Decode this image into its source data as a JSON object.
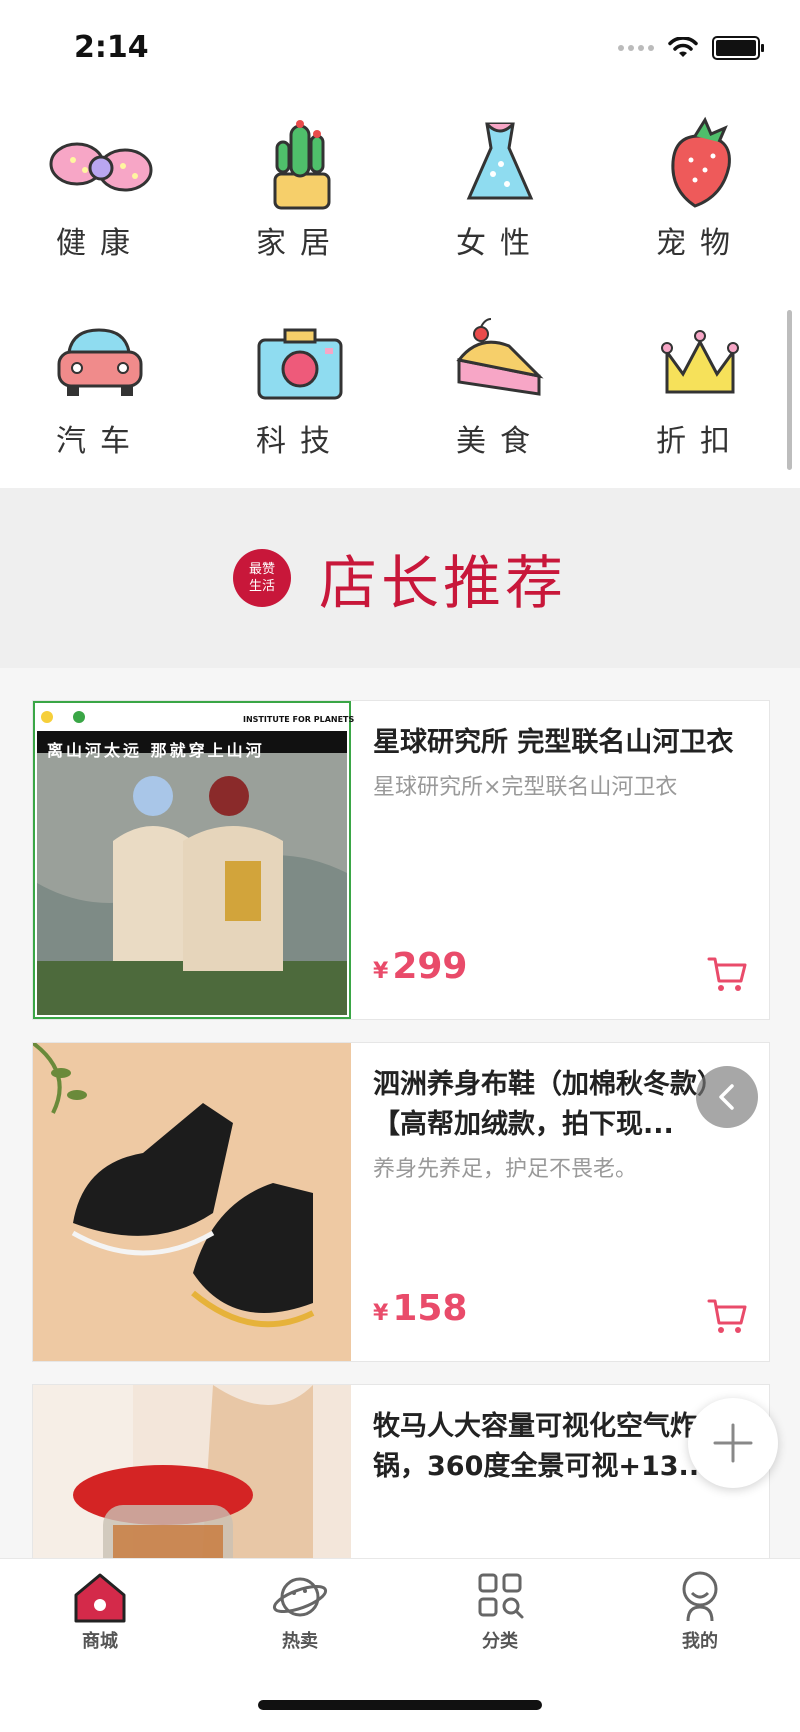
{
  "status_bar": {
    "time": "2:14"
  },
  "categories": [
    {
      "label": "健康",
      "icon": "bow-icon"
    },
    {
      "label": "家居",
      "icon": "cactus-icon"
    },
    {
      "label": "女性",
      "icon": "dress-icon"
    },
    {
      "label": "宠物",
      "icon": "strawberry-icon"
    },
    {
      "label": "汽车",
      "icon": "car-icon"
    },
    {
      "label": "科技",
      "icon": "camera-icon"
    },
    {
      "label": "美食",
      "icon": "cake-icon"
    },
    {
      "label": "折扣",
      "icon": "crown-icon"
    }
  ],
  "banner": {
    "badge_line1": "最赞",
    "badge_line2": "生活",
    "title": "店长推荐"
  },
  "products": [
    {
      "title": "星球研究所 完型联名山河卫衣",
      "subtitle": "星球研究所×完型联名山河卫衣",
      "currency": "¥",
      "price": "299",
      "image_text_1": "INSTITUTE FOR PLANETS",
      "image_text_2": "离山河太远 那就穿上山河"
    },
    {
      "title": "泗洲养身布鞋（加棉秋冬款）【高帮加绒款，拍下现...",
      "subtitle": "养身先养足，护足不畏老。",
      "currency": "¥",
      "price": "158"
    },
    {
      "title": "牧马人大容量可视化空气炸锅，360度全景可视+13...",
      "subtitle": "",
      "currency": "¥",
      "price": ""
    }
  ],
  "tabbar": [
    {
      "label": "商城",
      "icon": "home-icon"
    },
    {
      "label": "热卖",
      "icon": "planet-icon"
    },
    {
      "label": "分类",
      "icon": "category-search-icon"
    },
    {
      "label": "我的",
      "icon": "profile-icon"
    }
  ],
  "colors": {
    "accent": "#e94b6a",
    "brand_red": "#c8173a",
    "banner_bg": "#efefef"
  }
}
